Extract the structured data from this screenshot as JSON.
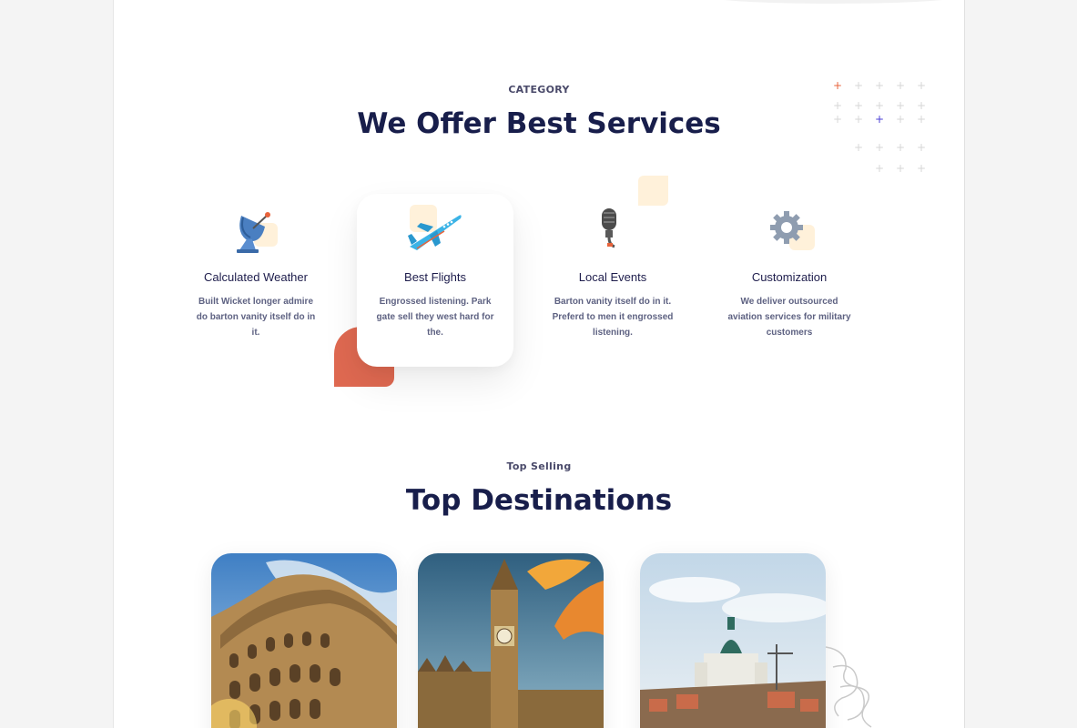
{
  "services_section": {
    "eyebrow": "CATEGORY",
    "title": "We Offer Best Services",
    "items": [
      {
        "icon": "satellite-dish-icon",
        "title": "Calculated Weather",
        "desc": "Built Wicket longer admire do barton vanity itself do in it."
      },
      {
        "icon": "airplane-icon",
        "title": "Best Flights",
        "desc": "Engrossed listening. Park gate sell they west hard for the."
      },
      {
        "icon": "microphone-icon",
        "title": "Local Events",
        "desc": "Barton vanity itself do in it. Preferd to men it engrossed listening."
      },
      {
        "icon": "gear-icon",
        "title": "Customization",
        "desc": "We deliver outsourced aviation services for military customers"
      }
    ]
  },
  "destinations_section": {
    "eyebrow": "Top Selling",
    "title": "Top Destinations",
    "cards": [
      {
        "image": "colosseum-rome-photo"
      },
      {
        "image": "big-ben-london-photo"
      },
      {
        "image": "helsinki-cathedral-photo"
      }
    ]
  },
  "colors": {
    "heading": "#181e4b",
    "accent_orange": "#df6951",
    "peach": "#fff1da",
    "text_muted": "#5e6282"
  }
}
